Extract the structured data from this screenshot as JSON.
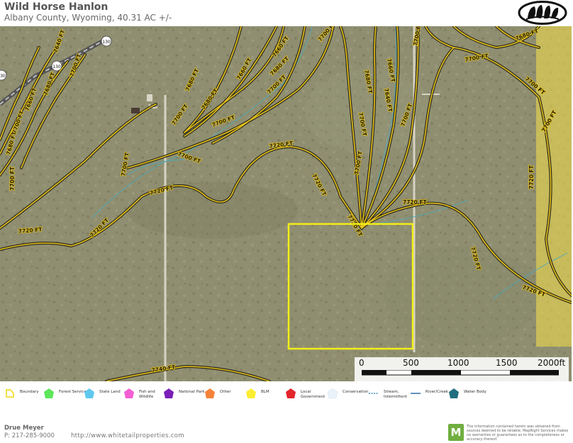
{
  "header": {
    "title": "Wild Horse Hanlon",
    "subtitle": "Albany County, Wyoming, 40.31 AC +/-"
  },
  "map": {
    "contours": {
      "c7640a": "7640 FT",
      "c7660a": "7660 FT",
      "c7680a": "7680 FT",
      "c7700a": "7700 FT",
      "c7720a": "7720 FT",
      "c7740a": "7740 FT"
    },
    "road_shields": [
      "130",
      "130",
      "130"
    ],
    "scale": {
      "labels": [
        "0",
        "500",
        "1000",
        "1500",
        "2000ft"
      ]
    },
    "colors": {
      "boundary": "#f2ee18",
      "blm": "#f5e04a",
      "contour": "#e6c21b",
      "stream": "#4fa8b8"
    }
  },
  "legend": {
    "items": [
      {
        "label": "Boundary",
        "color": "#f5e04a"
      },
      {
        "label": "Forest Service",
        "color": "#5ee65b"
      },
      {
        "label": "State Land",
        "color": "#5fc8ef"
      },
      {
        "label": "Fish and Wildlife",
        "color": "#f45fd4"
      },
      {
        "label": "National Park",
        "color": "#7a1fb8"
      },
      {
        "label": "Other",
        "color": "#f5823a"
      },
      {
        "label": "BLM",
        "color": "#fbee30"
      },
      {
        "label": "Local Government",
        "color": "#e3242b"
      },
      {
        "label": "Conservation",
        "color": "#eaf3fa"
      },
      {
        "label": "Stream, Intermittent",
        "color": "#3d8bb0"
      },
      {
        "label": "River/Creek",
        "color": "#2a6fa5"
      },
      {
        "label": "Water Body",
        "color": "#1f6f80"
      }
    ]
  },
  "footer": {
    "agent_name": "Drue Meyer",
    "agent_phone": "P: 217-285-9000",
    "website": "http://www.whitetailproperties.com",
    "mapright_logo": "M",
    "disclaimer": "The information contained herein was obtained from sources deemed to be reliable. MapRight Services makes no warranties or guarantees as to the completeness or accuracy thereof."
  }
}
